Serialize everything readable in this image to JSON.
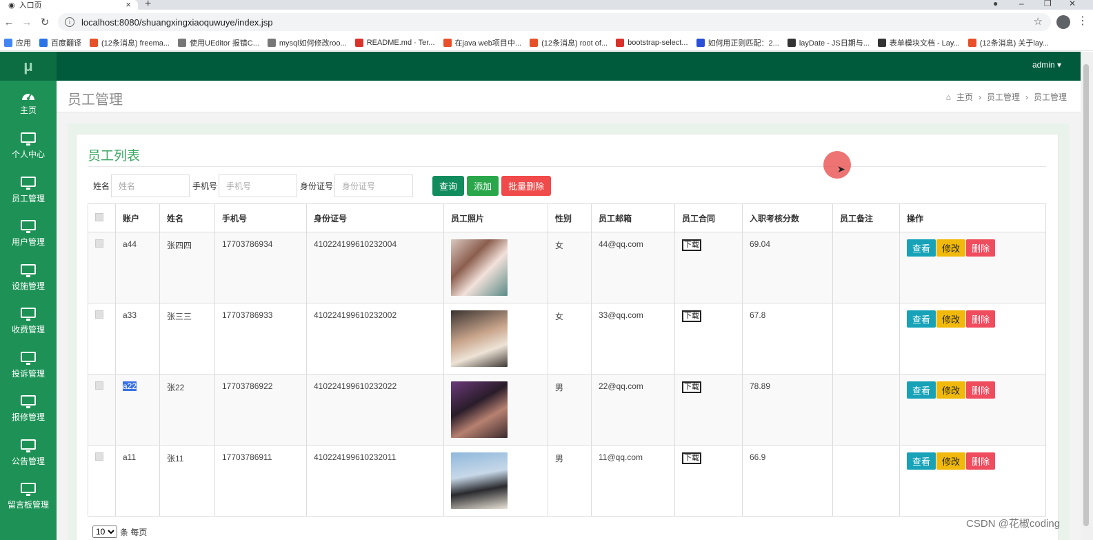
{
  "browser": {
    "tab_title": "入口页",
    "url": "localhost:8080/shuangxingxiaoquwuye/index.jsp",
    "bookmarks": [
      {
        "label": "应用",
        "color": "#4285f4"
      },
      {
        "label": "百度翻译",
        "color": "#2a74e8"
      },
      {
        "label": "(12条消息) freema...",
        "color": "#e8502a"
      },
      {
        "label": "使用UEditor 报错C...",
        "color": "#777777"
      },
      {
        "label": "mysql如何修改roo...",
        "color": "#777777"
      },
      {
        "label": "README.md · Ter...",
        "color": "#d9322b"
      },
      {
        "label": "在java web项目中...",
        "color": "#e8502a"
      },
      {
        "label": "(12条消息) root of...",
        "color": "#e8502a"
      },
      {
        "label": "bootstrap-select...",
        "color": "#d9322b"
      },
      {
        "label": "如何用正则匹配：2...",
        "color": "#2a4fd8"
      },
      {
        "label": "layDate - JS日期与...",
        "color": "#333333"
      },
      {
        "label": "表单模块文档 - Lay...",
        "color": "#333333"
      },
      {
        "label": "(12条消息) 关于lay...",
        "color": "#e8502a"
      }
    ]
  },
  "app": {
    "logo": "μ",
    "user": "admin",
    "sidebar": [
      {
        "label": "主页",
        "icon": "dashboard-icon"
      },
      {
        "label": "个人中心",
        "icon": "monitor-icon"
      },
      {
        "label": "员工管理",
        "icon": "monitor-icon"
      },
      {
        "label": "用户管理",
        "icon": "monitor-icon"
      },
      {
        "label": "设施管理",
        "icon": "monitor-icon"
      },
      {
        "label": "收费管理",
        "icon": "monitor-icon"
      },
      {
        "label": "投诉管理",
        "icon": "monitor-icon"
      },
      {
        "label": "报修管理",
        "icon": "monitor-icon"
      },
      {
        "label": "公告管理",
        "icon": "monitor-icon"
      },
      {
        "label": "留言板管理",
        "icon": "monitor-icon"
      }
    ],
    "page_title": "员工管理",
    "breadcrumb": [
      "主页",
      "员工管理",
      "员工管理"
    ],
    "card_title": "员工列表",
    "search": {
      "name_label": "姓名",
      "name_placeholder": "姓名",
      "phone_label": "手机号",
      "phone_placeholder": "手机号",
      "id_label": "身份证号",
      "id_placeholder": "身份证号",
      "query": "查询",
      "add": "添加",
      "batch_delete": "批量删除"
    },
    "columns": [
      "账户",
      "姓名",
      "手机号",
      "身份证号",
      "员工照片",
      "性别",
      "员工邮箱",
      "员工合同",
      "入职考核分数",
      "员工备注",
      "操作"
    ],
    "rows": [
      {
        "account": "a44",
        "name": "张四四",
        "phone": "17703786934",
        "idcard": "410224199610232004",
        "gender": "女",
        "email": "44@qq.com",
        "contract": "下载",
        "score": "69.04",
        "note": ""
      },
      {
        "account": "a33",
        "name": "张三三",
        "phone": "17703786933",
        "idcard": "410224199610232002",
        "gender": "女",
        "email": "33@qq.com",
        "contract": "下载",
        "score": "67.8",
        "note": ""
      },
      {
        "account": "a22",
        "name": "张22",
        "phone": "17703786922",
        "idcard": "410224199610232022",
        "gender": "男",
        "email": "22@qq.com",
        "contract": "下载",
        "score": "78.89",
        "note": ""
      },
      {
        "account": "a11",
        "name": "张11",
        "phone": "17703786911",
        "idcard": "410224199610232011",
        "gender": "男",
        "email": "11@qq.com",
        "contract": "下载",
        "score": "66.9",
        "note": ""
      }
    ],
    "ops": {
      "view": "查看",
      "edit": "修改",
      "delete": "删除"
    },
    "pager": {
      "size": "10",
      "suffix": "条 每页"
    },
    "watermark": "CSDN @花椒coding",
    "colors": {
      "sidebar": "#1e9256",
      "topnav": "#005a3c",
      "accent": "#3aa760"
    }
  }
}
